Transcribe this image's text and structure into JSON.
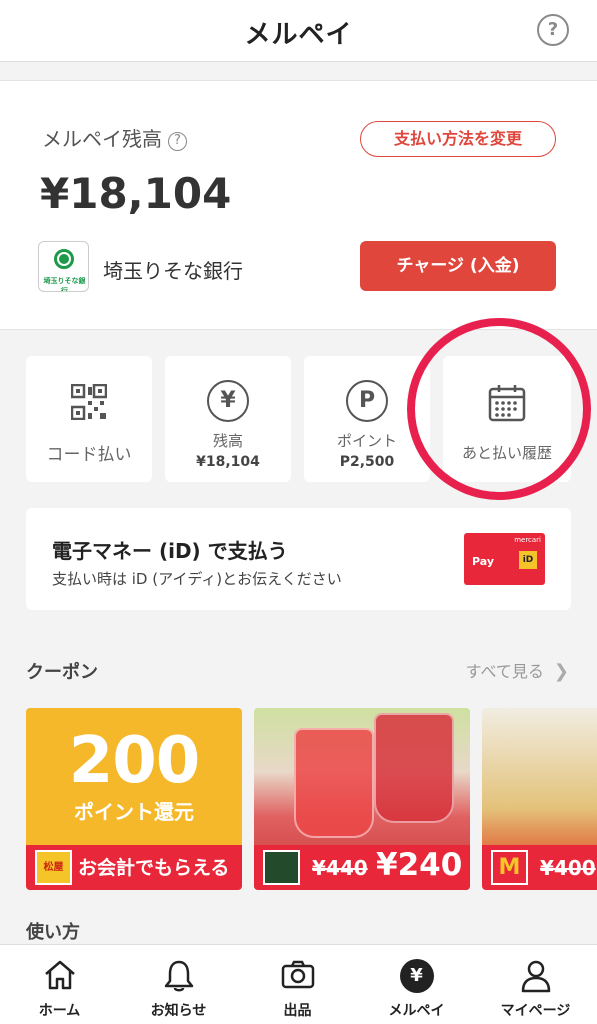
{
  "header": {
    "title": "メルペイ",
    "help_icon": "?"
  },
  "balance": {
    "label": "メルペイ残高",
    "info_icon": "?",
    "amount": "¥18,104",
    "change_payment_label": "支払い方法を変更",
    "bank_name": "埼玉りそな銀行",
    "bank_logo_text": "埼玉りそな銀行",
    "charge_label": "チャージ (入金)"
  },
  "tiles": {
    "code_pay": {
      "label": "コード払い"
    },
    "balance": {
      "icon": "¥",
      "label": "残高",
      "value": "¥18,104"
    },
    "points": {
      "icon": "P",
      "label": "ポイント",
      "value": "P2,500"
    },
    "deferred": {
      "label": "あと払い履歴"
    }
  },
  "id_card": {
    "title": "電子マネー (iD) で支払う",
    "subtitle": "支払い時は iD (アイディ)とお伝えください",
    "logo_brand": "mercari",
    "logo_pay": "Pay",
    "logo_id": "iD"
  },
  "coupons": {
    "title": "クーポン",
    "see_all": "すべて見る",
    "items": [
      {
        "big": "200",
        "sub": "ポイント還元",
        "store_logo": "松屋",
        "band_text": "お会計でもらえる"
      },
      {
        "old_price": "¥440",
        "new_price": "¥240"
      },
      {
        "store_logo": "M",
        "old_price": "¥400"
      }
    ]
  },
  "howto": {
    "title": "使い方"
  },
  "tabbar": {
    "home": "ホーム",
    "notifications": "お知らせ",
    "sell": "出品",
    "merpay": "メルペイ",
    "mypage": "マイページ",
    "merpay_icon": "¥"
  },
  "colors": {
    "accent": "#e0463c",
    "highlight": "#e8204e"
  }
}
